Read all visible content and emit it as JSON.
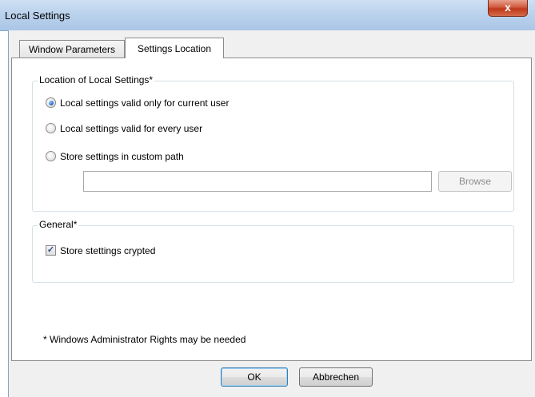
{
  "window": {
    "title": "Local Settings",
    "close_glyph": "x"
  },
  "tabs": [
    {
      "label": "Window Parameters",
      "active": false
    },
    {
      "label": "Settings Location",
      "active": true
    }
  ],
  "location_group": {
    "title": "Location of Local Settings*",
    "options": [
      {
        "label": "Local settings valid only for current user",
        "checked": true
      },
      {
        "label": "Local settings valid for every user",
        "checked": false
      },
      {
        "label": "Store settings in custom path",
        "checked": false
      }
    ],
    "custom_path_value": "",
    "browse_label": "Browse"
  },
  "general_group": {
    "title": "General*",
    "crypt_label": "Store stettings crypted",
    "crypt_checked": true,
    "check_glyph": "✓"
  },
  "footnote": "* Windows Administrator Rights may be needed",
  "buttons": {
    "ok": "OK",
    "cancel": "Abbrechen"
  },
  "colors": {
    "accent": "#3c7fb1",
    "close": "#c0381b"
  }
}
